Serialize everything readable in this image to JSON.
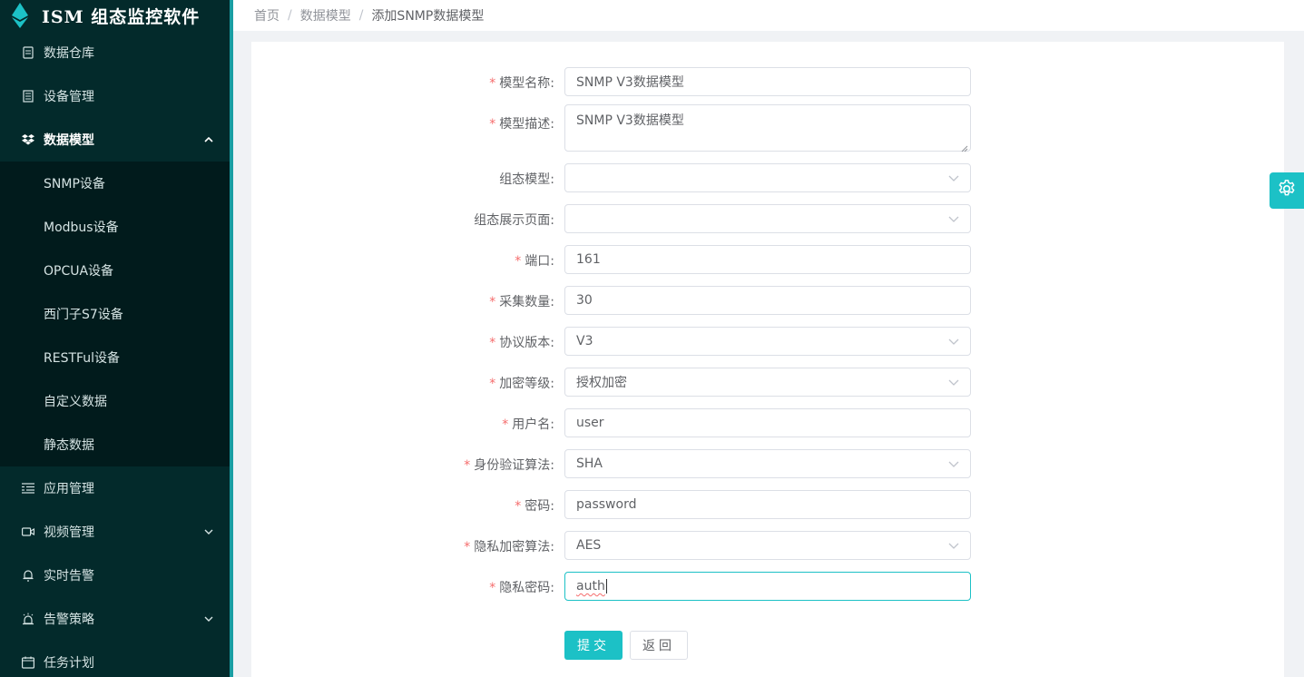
{
  "app": {
    "title": "ISM 组态监控软件"
  },
  "sidebar": {
    "items": [
      {
        "label": "数据仓库",
        "icon": "database-icon"
      },
      {
        "label": "设备管理",
        "icon": "device-icon"
      },
      {
        "label": "数据模型",
        "icon": "dropbox-icon",
        "expanded": true,
        "children": [
          "SNMP设备",
          "Modbus设备",
          "OPCUA设备",
          "西门子S7设备",
          "RESTFul设备",
          "自定义数据",
          "静态数据"
        ]
      },
      {
        "label": "应用管理",
        "icon": "list-icon"
      },
      {
        "label": "视频管理",
        "icon": "video-icon",
        "has_children": true
      },
      {
        "label": "实时告警",
        "icon": "bell-icon"
      },
      {
        "label": "告警策略",
        "icon": "alarm-icon",
        "has_children": true
      },
      {
        "label": "任务计划",
        "icon": "calendar-icon"
      }
    ]
  },
  "breadcrumb": [
    "首页",
    "数据模型",
    "添加SNMP数据模型"
  ],
  "form": {
    "model_name": {
      "label": "模型名称:",
      "required": true,
      "value": "SNMP V3数据模型"
    },
    "model_desc": {
      "label": "模型描述:",
      "required": true,
      "value": "SNMP V3数据模型"
    },
    "config_model": {
      "label": "组态模型:",
      "required": false,
      "value": ""
    },
    "config_page": {
      "label": "组态展示页面:",
      "required": false,
      "value": ""
    },
    "port": {
      "label": "端口:",
      "required": true,
      "value": "161"
    },
    "collect_count": {
      "label": "采集数量:",
      "required": true,
      "value": "30"
    },
    "protocol_version": {
      "label": "协议版本:",
      "required": true,
      "value": "V3"
    },
    "security_level": {
      "label": "加密等级:",
      "required": true,
      "value": "授权加密"
    },
    "username": {
      "label": "用户名:",
      "required": true,
      "value": "user"
    },
    "auth_algorithm": {
      "label": "身份验证算法:",
      "required": true,
      "value": "SHA"
    },
    "password": {
      "label": "密码:",
      "required": true,
      "value": "password"
    },
    "privacy_algorithm": {
      "label": "隐私加密算法:",
      "required": true,
      "value": "AES"
    },
    "privacy_password": {
      "label": "隐私密码:",
      "required": true,
      "value": "auth"
    },
    "required_mark": "*"
  },
  "buttons": {
    "submit": "提交",
    "back": "返回"
  },
  "colors": {
    "accent": "#1cc1c6",
    "sidebar_bg": "#032a2b",
    "submenu_bg": "#011b1c",
    "required": "#f56c6c"
  }
}
